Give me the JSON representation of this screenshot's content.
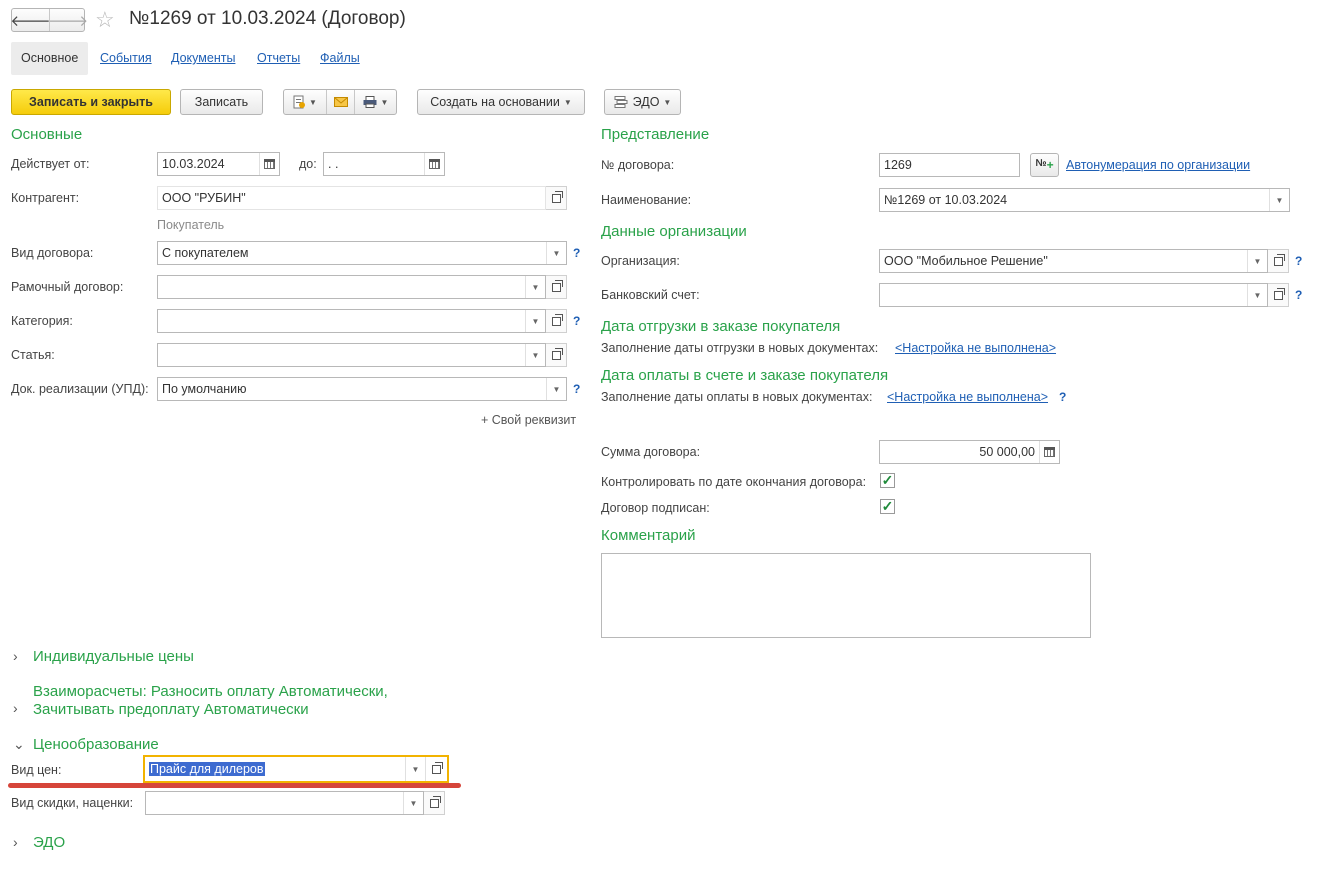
{
  "header": {
    "back_icon": "arrow-left-icon",
    "forward_icon": "arrow-right-icon",
    "favorite_icon": "star-icon",
    "title": "№1269 от 10.03.2024 (Договор)"
  },
  "tabs": [
    "Основное",
    "События",
    "Документы",
    "Отчеты",
    "Файлы"
  ],
  "toolbar": {
    "save_close": "Записать и закрыть",
    "save": "Записать",
    "create_based": "Создать на основании",
    "edo": "ЭДО"
  },
  "left": {
    "section_title": "Основные",
    "valid_from_label": "Действует от:",
    "valid_from": "10.03.2024",
    "valid_to_label": "до:",
    "valid_to": " .  .",
    "counterparty_label": "Контрагент:",
    "counterparty": "ООО \"РУБИН\"",
    "counterparty_role": "Покупатель",
    "contract_type_label": "Вид договора:",
    "contract_type": "С покупателем",
    "frame_contract_label": "Рамочный договор:",
    "frame_contract": "",
    "category_label": "Категория:",
    "category": "",
    "article_label": "Статья:",
    "article": "",
    "sales_doc_label": "Док. реализации (УПД):",
    "sales_doc": "По умолчанию",
    "custom_attr": "+ Свой реквизит"
  },
  "right": {
    "section_title": "Представление",
    "number_label": "№ договора:",
    "number": "1269",
    "autonumber_link": "Автонумерация по организации",
    "name_label": "Наименование:",
    "name": "№1269 от 10.03.2024",
    "org_section": "Данные организации",
    "org_label": "Организация:",
    "org": "ООО \"Мобильное Решение\"",
    "bank_label": "Банковский счет:",
    "bank": "",
    "ship_section": "Дата отгрузки в заказе покупателя",
    "ship_fill_label": "Заполнение даты отгрузки в новых документах:",
    "ship_fill_link": "<Настройка не выполнена>",
    "pay_section": "Дата оплаты в счете и заказе покупателя",
    "pay_fill_label": "Заполнение даты оплаты в новых документах:",
    "pay_fill_link": "<Настройка не выполнена>",
    "sum_label": "Сумма договора:",
    "sum": "50 000,00",
    "control_label": "Контролировать по дате окончания договора:",
    "control_checked": true,
    "signed_label": "Договор подписан:",
    "signed_checked": true,
    "comment_section": "Комментарий",
    "comment": ""
  },
  "groups": {
    "individual_prices": "Индивидуальные цены",
    "settlements_line1": "Взаиморасчеты: Разносить оплату Автоматически,",
    "settlements_line2": "Зачитывать предоплату Автоматически",
    "pricing": "Ценообразование",
    "price_type_label": "Вид цен:",
    "price_type": "Прайс для дилеров",
    "discount_label": "Вид скидки, наценки:",
    "discount": "",
    "edo": "ЭДО"
  },
  "help_mark": "?",
  "colors": {
    "section": "#2aa24a",
    "link": "#1f5fb4",
    "primary_button": "#f5cc0a",
    "highlight_border": "#f2b300",
    "annotation": "#d6453a"
  }
}
